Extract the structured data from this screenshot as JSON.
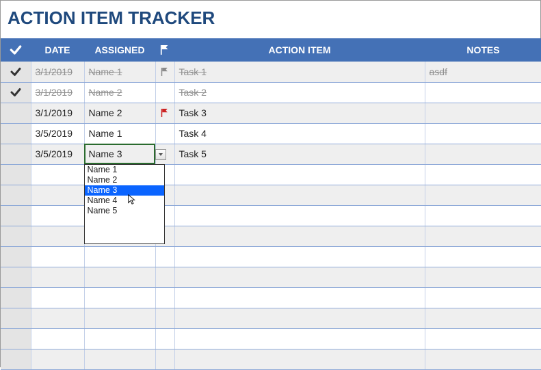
{
  "title": "ACTION ITEM TRACKER",
  "columns": {
    "date": "DATE",
    "assigned": "ASSIGNED",
    "action": "ACTION ITEM",
    "notes": "NOTES"
  },
  "rows": [
    {
      "done": true,
      "flag": "gray",
      "date": "3/1/2019",
      "assigned": "Name 1",
      "action": "Task 1",
      "notes": "asdf"
    },
    {
      "done": true,
      "flag": "",
      "date": "3/1/2019",
      "assigned": "Name 2",
      "action": "Task 2",
      "notes": ""
    },
    {
      "done": false,
      "flag": "red",
      "date": "3/1/2019",
      "assigned": "Name 2",
      "action": "Task 3",
      "notes": ""
    },
    {
      "done": false,
      "flag": "",
      "date": "3/5/2019",
      "assigned": "Name 1",
      "action": "Task 4",
      "notes": ""
    },
    {
      "done": false,
      "flag": "",
      "date": "3/5/2019",
      "assigned": "Name 3",
      "action": "Task 5",
      "notes": "",
      "editing": true
    }
  ],
  "empty_row_count": 10,
  "dropdown": {
    "options": [
      "Name 1",
      "Name 2",
      "Name 3",
      "Name 4",
      "Name 5"
    ],
    "selected_index": 2
  }
}
